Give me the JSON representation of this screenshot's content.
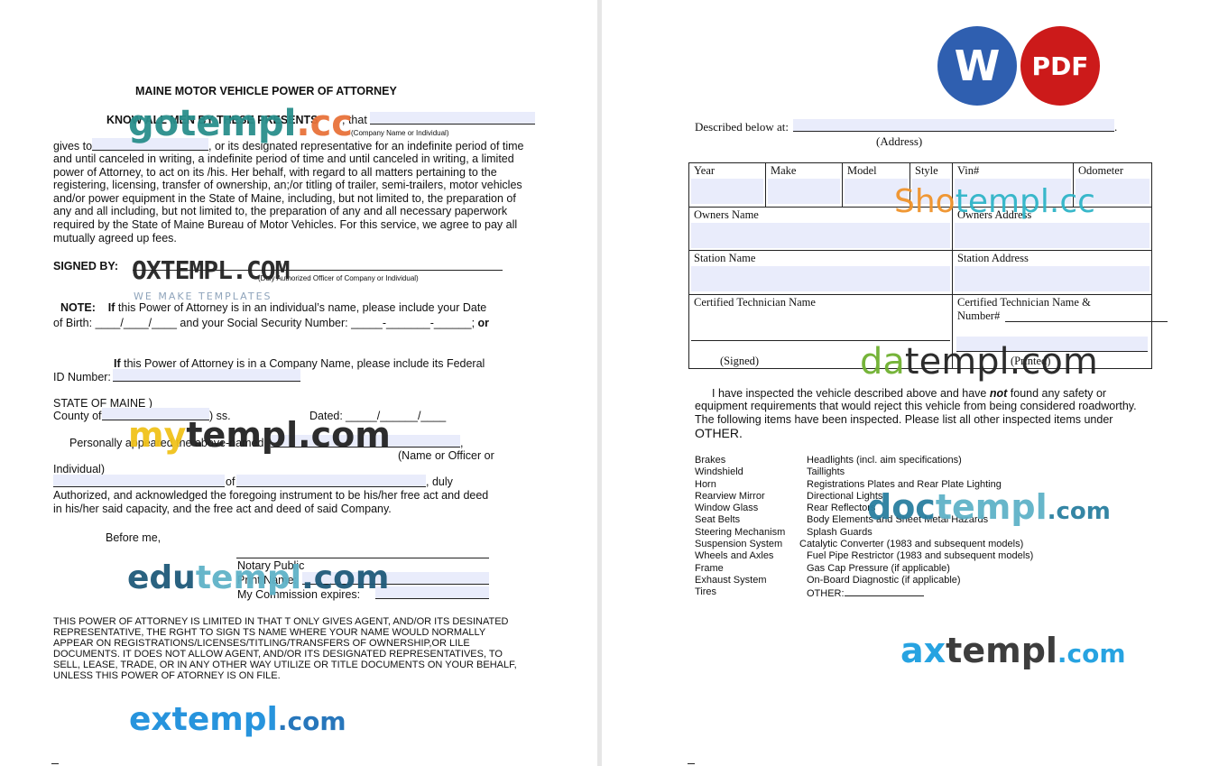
{
  "left": {
    "title": "MAINE MOTOR VEHICLE POWER OF  ATTORNEY",
    "know_all": "KNOW ALL MEN BY THESE PRESENTS",
    "know_that": ", that",
    "company_hint": "(Company Name or Individual)",
    "gives_to": "gives to",
    "gives_to_rest": ", or its designated representative for an indefinite period of time",
    "body_lines": [
      "and until canceled in writing, a indefinite period of time  and until canceled in writing, a limited",
      "power of Attorney, to act on its /his. Her behalf, with regard to all matters pertaining to the",
      "registering, licensing, transfer of ownership, an;/or titling of trailer, semi-trailers, motor vehicles",
      "and/or power equipment in the State of Maine, including, but not limited to, the preparation of",
      "any and all including, but not limited to, the preparation of any and all necessary paperwork",
      "required by the State of Maine Bureau of Motor Vehicles. For this service, we agree to pay all",
      "mutually agreed up fees."
    ],
    "signed_by": "SIGNED BY:",
    "signed_hint": "(Duly Authorized Officer of Company or Individual)",
    "note_label": "NOTE:",
    "note_if": "If",
    "note_text": "this Power of Attorney is in an individual’s name, please include your Date",
    "dob_label": "of Birth:",
    "dob_blanks": "____/____/____",
    "ssn_label": "and your Social Security Number:",
    "ssn_blanks": "_____-_______-______;",
    "or": "or",
    "company_if": "If",
    "company_text": "this Power of Attorney is in a Company Name, please include its Federal",
    "id_number": "ID Number:",
    "state_of_maine": "STATE OF MAINE )",
    "county_of": "County of",
    "ss": ") ss.",
    "dated": "Dated:",
    "dated_blanks": "_____/______/____",
    "personally": "Personally appeared the above-named",
    "name_officer": "(Name or Officer or",
    "individual": "Individual)",
    "of": "of",
    "duly": ", duly",
    "ack_lines": [
      "Authorized, and acknowledged the foregoing instrument to be his/her free act and deed",
      "in his/her said capacity, and the free act and deed of said Company."
    ],
    "before_me": "Before me,",
    "notary_public": "Notary Public",
    "print_name": "Print Name:",
    "commission": "My Commission expires:",
    "disclaimer": [
      "     THIS POWER OF ATTORNEY IS LIMITED IN THAT T ONLY GIVES AGENT, AND/OR ITS DESINATED",
      "REPRESENTATIVE, THE RGHT TO SIGN TS NAME WHERE YOUR NAME WOULD NORMALLY",
      "APPEAR ON REGISTRATIONS/LICENSES/TITLING/TRANSFERS OF OWNERSHIP,OR LILE",
      "DOCUMENTS. IT DOES NOT ALLOW AGENT, AND/OR ITS DESIGNATED REPRESENTATIVES, TO",
      "SELL, LEASE, TRADE, OR IN ANY OTHER WAY UTILIZE OR TITLE DOCUMENTS ON YOUR BEHALF,",
      "UNLESS THIS POWER OF ATORNEY IS ON FILE."
    ]
  },
  "right": {
    "described": "Described below at:",
    "described_end": ".",
    "address_hint": "(Address)",
    "table": {
      "headers": [
        "Year",
        "Make",
        "Model",
        "Style",
        "Vin#",
        "Odometer"
      ],
      "owners_name": "Owners Name",
      "owners_address": "Owners Address",
      "station_name": "Station Name",
      "station_address": "Station Address",
      "tech_name": "Certified Technician Name",
      "tech_name_number_1": "Certified Technician Name &",
      "tech_name_number_2": "Number#",
      "signed": "(Signed)",
      "printed": "(Printed)"
    },
    "inspect_1_pre": "I have inspected the vehicle described above and have ",
    "inspect_not": "not",
    "inspect_1_post": " found any safety or",
    "inspect_2": "equipment requirements that would reject this vehicle from being considered roadworthy.",
    "inspect_3": "The following items have been inspected. Please list all other inspected items under",
    "other": "OTHER.",
    "items_left": [
      "Brakes",
      "Windshield",
      "Horn",
      "Rearview Mirror",
      "Window Glass",
      "Seat Belts",
      "Steering Mechanism",
      "Suspension  System",
      "Wheels and Axles",
      "Frame",
      "Exhaust System",
      "Tires"
    ],
    "items_right": [
      "Headlights (incl. aim specifications)",
      "Taillights",
      "Registrations Plates and Rear Plate Lighting",
      "Directional Lights",
      "Rear Reflectors",
      "Body Elements and Sheet Metal Hazards",
      "Splash Guards",
      "Catalytic  Converter  (1983  and  subsequent  models)",
      "Fuel Pipe Restrictor  (1983 and subsequent models)",
      "Gas Cap Pressure  (if applicable)",
      "On-Board Diagnostic (if applicable)",
      "OTHER:"
    ]
  },
  "badges": {
    "word": "W",
    "pdf": "PDF",
    "word_color": "#2f5fb0",
    "pdf_color": "#cc1a1a"
  },
  "watermarks": {
    "gotempl_a": "gotempl",
    "gotempl_b": ".cc",
    "oxtempl": "OXTEMPL.COM",
    "oxtempl_sub": "WE MAKE TEMPLATES",
    "mytempl_a": "my",
    "mytempl_b": "templ.com",
    "edutempl_a": "edu",
    "edutempl_b": "templ",
    "edutempl_c": ".com",
    "extempl_a": "extempl",
    "extempl_b": ".com",
    "shotempl_a": "Sho",
    "shotempl_b": "templ.cc",
    "datempl_a": "da",
    "datempl_b": "templ.com",
    "doctempl_a": "doc",
    "doctempl_b": "templ",
    "doctempl_c": ".com",
    "axtempl_a": "ax",
    "axtempl_b": "templ",
    "axtempl_c": ".com"
  }
}
